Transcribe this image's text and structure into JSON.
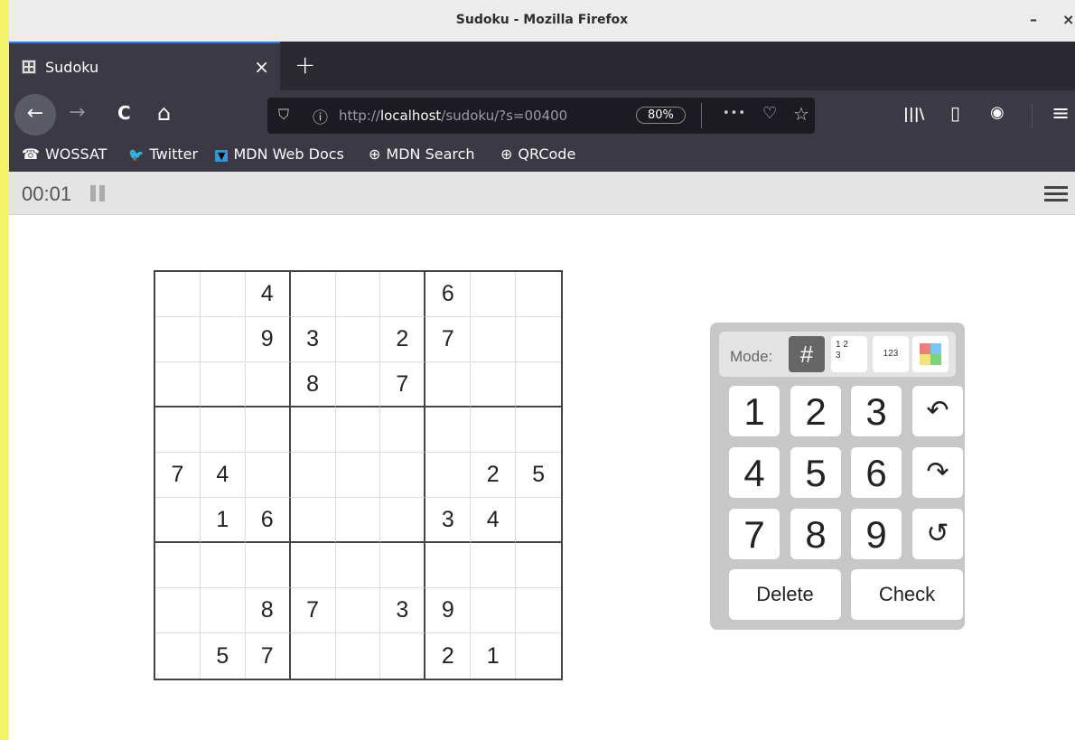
{
  "window": {
    "title": "Sudoku - Mozilla Firefox",
    "minimize": "–",
    "close": "×"
  },
  "tab": {
    "label": "Sudoku",
    "close": "×",
    "new_tab": "+"
  },
  "nav": {
    "back": "←",
    "forward": "→",
    "reload": "C",
    "home": "⌂",
    "url_prefix": "http://",
    "url_host": "localhost",
    "url_path": "/sudoku/?s=00400",
    "zoom": "80%",
    "more": "•••",
    "pocket": "♡",
    "bookmark": "☆",
    "library": "|||\\",
    "sidebar": "▯",
    "account": "◉",
    "menu": "≡"
  },
  "bookmarks": [
    {
      "icon": "☎",
      "label": "WOSSAT"
    },
    {
      "icon": "🐦",
      "label": "Twitter"
    },
    {
      "icon": "▼",
      "label": "MDN Web Docs"
    },
    {
      "icon": "⊕",
      "label": "MDN Search"
    },
    {
      "icon": "⊕",
      "label": "QRCode"
    }
  ],
  "app": {
    "timer": "00:01",
    "paused": false
  },
  "grid": [
    [
      "",
      "",
      "4",
      "",
      "",
      "",
      "6",
      "",
      ""
    ],
    [
      "",
      "",
      "9",
      "3",
      "",
      "2",
      "7",
      "",
      ""
    ],
    [
      "",
      "",
      "",
      "8",
      "",
      "7",
      "",
      "",
      ""
    ],
    [
      "",
      "",
      "",
      "",
      "",
      "",
      "",
      "",
      ""
    ],
    [
      "7",
      "4",
      "",
      "",
      "",
      "",
      "",
      "2",
      "5"
    ],
    [
      "",
      "1",
      "6",
      "",
      "",
      "",
      "3",
      "4",
      ""
    ],
    [
      "",
      "",
      "",
      "",
      "",
      "",
      "",
      "",
      ""
    ],
    [
      "",
      "",
      "8",
      "7",
      "",
      "3",
      "9",
      "",
      ""
    ],
    [
      "",
      "5",
      "7",
      "",
      "",
      "",
      "2",
      "1",
      ""
    ]
  ],
  "pad": {
    "mode_label": "Mode:",
    "mode_digit": "#",
    "mode_notes_top": "1  2",
    "mode_notes_bottom": "3",
    "mode_digits": "123",
    "colors": [
      "#f47b7b",
      "#7bc4f4",
      "#f4e27b",
      "#7bd47b"
    ],
    "keys": [
      "1",
      "2",
      "3",
      "4",
      "5",
      "6",
      "7",
      "8",
      "9"
    ],
    "undo": "↶",
    "redo": "↷",
    "restart": "↺",
    "delete": "Delete",
    "check": "Check"
  }
}
